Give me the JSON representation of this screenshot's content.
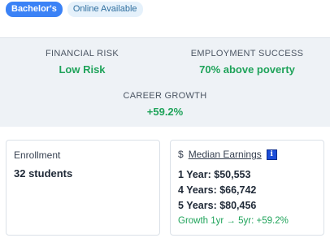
{
  "badges": {
    "degree": "Bachelor's",
    "availability": "Online Available"
  },
  "stats": {
    "financial_risk": {
      "label": "FINANCIAL RISK",
      "value": "Low Risk"
    },
    "employment_success": {
      "label": "EMPLOYMENT SUCCESS",
      "value": "70% above poverty"
    },
    "career_growth": {
      "label": "CAREER GROWTH",
      "value": "+59.2%"
    }
  },
  "enrollment": {
    "title": "Enrollment",
    "value": "32 students"
  },
  "earnings": {
    "icon": "$",
    "title": "Median Earnings",
    "info_icon": "i",
    "rows": [
      "1 Year: $50,553",
      "4 Years: $66,742",
      "5 Years: $80,456"
    ],
    "growth": "Growth 1yr → 5yr: +59.2%"
  },
  "colors": {
    "accent": "#3b82f6",
    "positive": "#1fa35a",
    "stats_background": "#eef2f6"
  }
}
